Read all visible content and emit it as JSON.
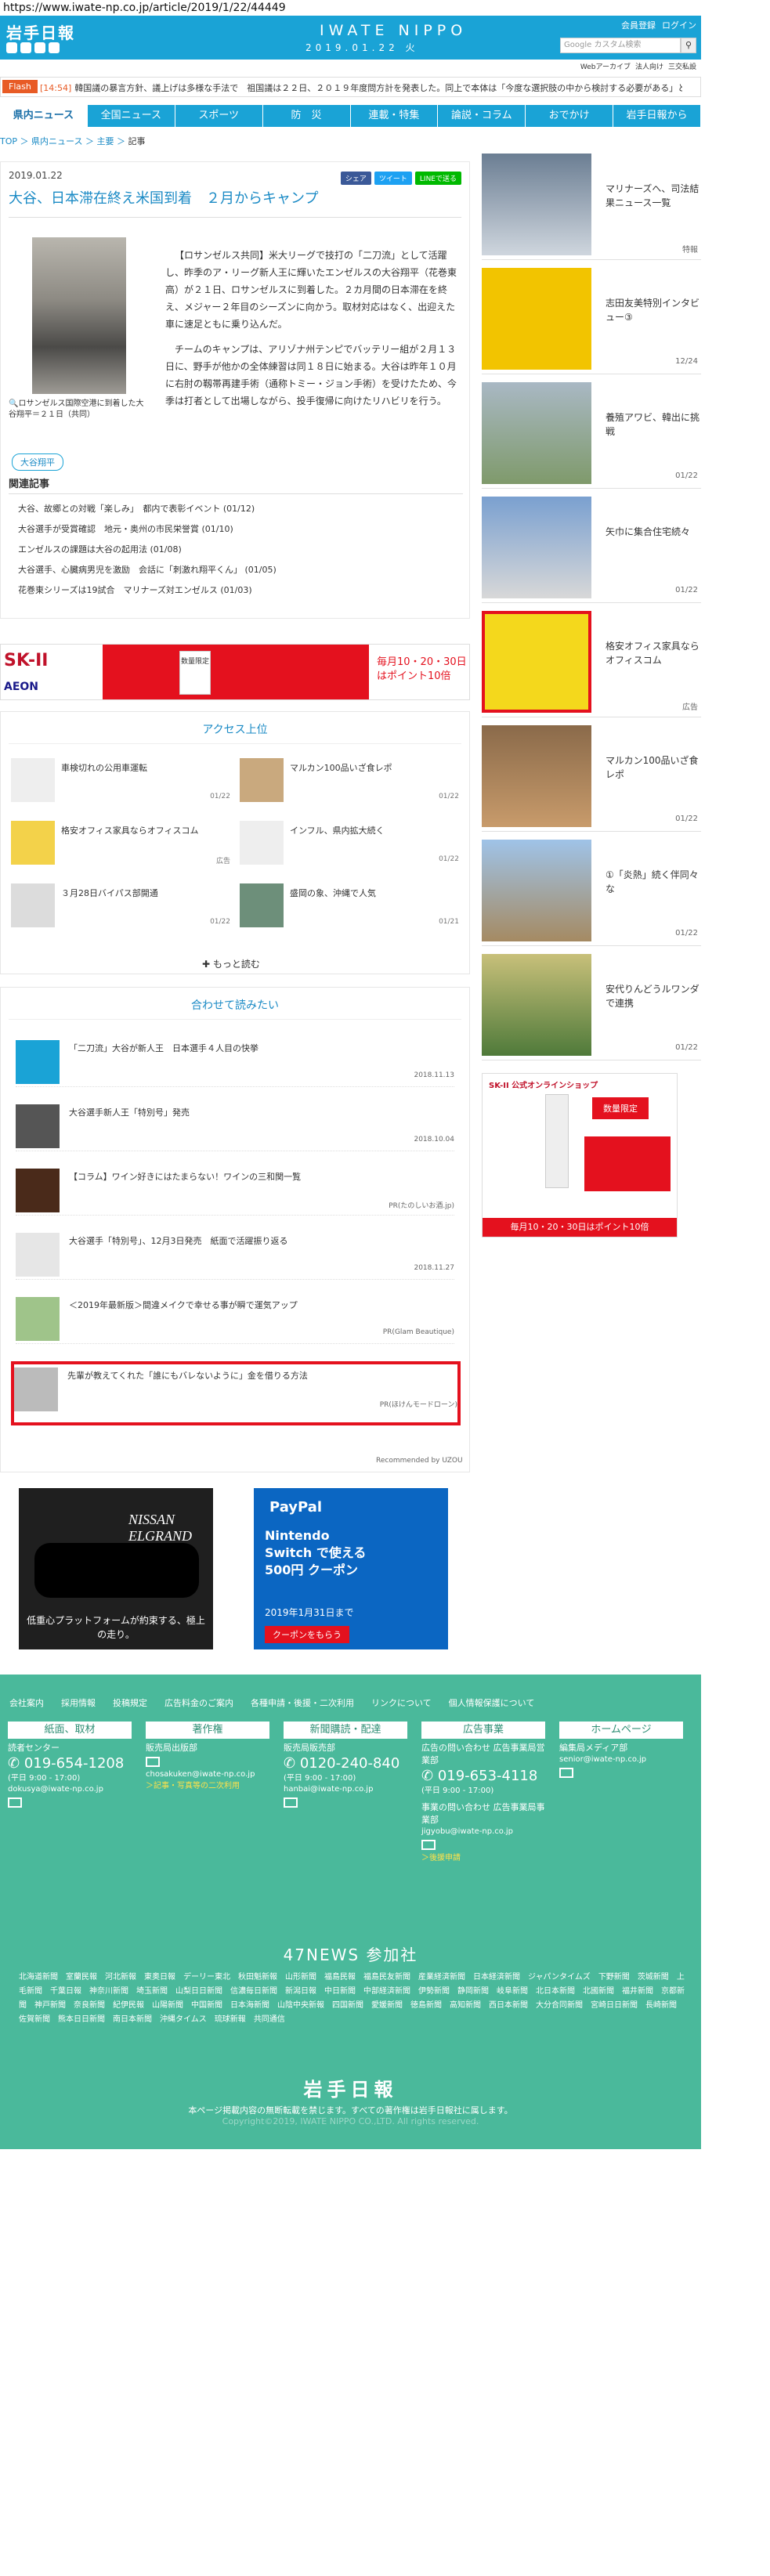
{
  "url": "https://www.iwate-np.co.jp/article/2019/1/22/44449",
  "header": {
    "logo": "岩手日報",
    "brand": "IWATE NIPPO",
    "date": "2019.01.22 火",
    "toplinks": [
      "会員登録",
      "ログイン"
    ],
    "sublinks": [
      "Webアーカイブ",
      "法人向け",
      "三交私設"
    ],
    "search_placeholder": "Google カスタム検索"
  },
  "flash": {
    "label": "Flash",
    "time": "[14:54]",
    "text": "韓国議の暴言方針、議上げは多様な手法で　祖国議は２２日、２０１９年度問方計を発表した。同上で本体は「今度な選択肢の中から検討する必要がある」と…"
  },
  "nav": [
    "県内ニュース",
    "全国ニュース",
    "スポーツ",
    "防　災",
    "連載・特集",
    "論説・コラム",
    "おでかけ",
    "岩手日報から"
  ],
  "breadcrumb": [
    "TOP",
    "県内ニュース",
    "主要",
    "記事"
  ],
  "article": {
    "date": "2019.01.22",
    "share": [
      "シェア",
      "ツイート",
      "LINEで送る"
    ],
    "title": "大谷、日本滞在終え米国到着　２月からキャンプ",
    "caption": "ロサンゼルス国際空港に到着した大谷翔平＝２１日（共同）",
    "body": [
      "【ロサンゼルス共同】米大リーグで技打の「二刀流」として活躍し、昨季のア・リーグ新人王に輝いたエンゼルスの大谷翔平（花巻東高）が２１日、ロサンゼルスに到着した。２カ月間の日本滞在を終え、メジャー２年目のシーズンに向かう。取材対応はなく、出迎えた車に速足ともに乗り込んだ。",
      "チームのキャンプは、アリゾナ州テンピでバッテリー組が２月１３日に、野手が他かの全体練習は同１８日に始まる。大谷は昨年１０月に右肘の靱帯再建手術（通称トミー・ジョン手術）を受けたため、今季は打者として出場しながら、投手復帰に向けたリハビリを行う。"
    ],
    "tag": "大谷翔平",
    "related_title": "関連記事",
    "related": [
      "大谷、故郷との対戦「楽しみ」　都内で表彰イベント (01/12)",
      "大谷選手が受賞確認　地元・奥州の市民栄誉賞 (01/10)",
      "エンゼルスの課題は大谷の起用法 (01/08)",
      "大谷選手、心臓病男児を激励　会話に「刺激れ翔平くん」 (01/05)",
      "花巻東シリーズは19試合　マリナーズ対エンゼルス (01/03)"
    ]
  },
  "ad_banner": {
    "brand": "SK-II",
    "sub": "AEON",
    "product_label": "数量限定",
    "points": "毎月10・20・30日はポイント10倍"
  },
  "access": {
    "title": "アクセス上位",
    "items": [
      {
        "title": "車検切れの公用車運転",
        "date": "01/22"
      },
      {
        "title": "マルカン100品いざ食レポ",
        "date": "01/22"
      },
      {
        "title": "格安オフィス家具ならオフィスコム",
        "date": "広告"
      },
      {
        "title": "インフル、県内拡大続く",
        "date": "01/22"
      },
      {
        "title": "３月28日バイパス部開通",
        "date": "01/22"
      },
      {
        "title": "盛岡の象、沖縄で人気",
        "date": "01/21"
      }
    ],
    "more": "もっと読む"
  },
  "recommend": {
    "title": "合わせて読みたい",
    "items": [
      {
        "title": "「二刀流」大谷が新人王　日本選手４人目の快挙",
        "meta": "2018.11.13"
      },
      {
        "title": "大谷選手新人王「特別号」発売",
        "meta": "2018.10.04"
      },
      {
        "title": "【コラム】ワイン好きにはたまらない！ワインの三和関一覧",
        "meta": "PR(たのしいお酒.jp)"
      },
      {
        "title": "大谷選手「特別号」、12月3日発売　紙面で活躍振り返る",
        "meta": "2018.11.27"
      },
      {
        "title": "＜2019年最新版＞間違メイクで幸せる事が瞬で運気アップ",
        "meta": "PR(Glam Beautique)"
      },
      {
        "title": "先輩が教えてくれた「誰にもバレないように」金を借りる方法",
        "meta": "PR(ほけんモードローン)"
      }
    ],
    "powered": "Recommended by UZOU"
  },
  "ads2": {
    "left_brand": "NISSAN ELGRAND",
    "left_text": "低重心プラットフォームが約束する、極上の走り。",
    "right_title": "PayPal",
    "right_text": "Nintendo Switch で使える 500円 クーポン",
    "right_date": "2019年1月31日まで",
    "right_button": "クーポンをもらう"
  },
  "sidebar": [
    {
      "title": "マリナーズへ、司法結果ニュース一覧",
      "date": "特報"
    },
    {
      "title": "志田友美特別インタビュー③",
      "date": "12/24"
    },
    {
      "title": "養殖アワビ、韓出に挑戦",
      "date": "01/22"
    },
    {
      "title": "矢巾に集合住宅続々",
      "date": "01/22"
    },
    {
      "title": "格安オフィス家具ならオフィスコム",
      "date": "広告"
    },
    {
      "title": "マルカン100品いざ食レポ",
      "date": "01/22"
    },
    {
      "title": "①「炎熱」続く伴同々な",
      "date": "01/22"
    },
    {
      "title": "安代りんどうルワンダで連携",
      "date": "01/22"
    }
  ],
  "side_ad": {
    "brand": "SK-II 公式オンラインショップ",
    "label": "数量限定",
    "points": "毎月10・20・30日はポイント10倍"
  },
  "footer": {
    "links": [
      "会社案内",
      "採用情報",
      "投稿規定",
      "広告料金のご案内",
      "各種申請・後援・二次利用",
      "リンクについて",
      "個人情報保護について"
    ],
    "cols": [
      {
        "head": "紙面、取材",
        "title": "読者センター",
        "tel": "019-654-1208",
        "hours": "(平日 9:00 - 17:00)",
        "mail": "dokusya@iwate-np.co.jp"
      },
      {
        "head": "著作権",
        "title": "販売局出版部",
        "mail": "chosakuken@iwate-np.co.jp",
        "link": "＞記事・写真等の二次利用"
      },
      {
        "head": "新聞購読・配達",
        "title": "販売局販売部",
        "tel": "0120-240-840",
        "hours": "(平日 9:00 - 17:00)",
        "mail": "hanbai@iwate-np.co.jp"
      },
      {
        "head": "広告事業",
        "title": "広告の問い合わせ 広告事業局営業部",
        "tel": "019-653-4118",
        "hours": "(平日 9:00 - 17:00)",
        "title2": "事業の問い合わせ 広告事業局事業部",
        "mail": "jigyobu@iwate-np.co.jp",
        "link": "＞後援申請"
      },
      {
        "head": "ホームページ",
        "title": "編集局メディア部",
        "mail": "senior@iwate-np.co.jp"
      }
    ],
    "n47": "47NEWS 参加社",
    "papers": [
      "北海道新聞",
      "室蘭民報",
      "河北新報",
      "東奥日報",
      "デーリー東北",
      "秋田魁新報",
      "山形新聞",
      "福島民報",
      "福島民友新聞",
      "産業経済新聞",
      "日本経済新聞",
      "ジャパンタイムズ",
      "下野新聞",
      "茨城新聞",
      "上毛新聞",
      "千葉日報",
      "神奈川新聞",
      "埼玉新聞",
      "山梨日日新聞",
      "信濃毎日新聞",
      "新潟日報",
      "中日新聞",
      "中部経済新聞",
      "伊勢新聞",
      "静岡新聞",
      "岐阜新聞",
      "北日本新聞",
      "北國新聞",
      "福井新聞",
      "京都新聞",
      "神戸新聞",
      "奈良新聞",
      "紀伊民報",
      "山陽新聞",
      "中国新聞",
      "日本海新聞",
      "山陰中央新報",
      "四国新聞",
      "愛媛新聞",
      "徳島新聞",
      "高知新聞",
      "西日本新聞",
      "大分合同新聞",
      "宮崎日日新聞",
      "長崎新聞",
      "佐賀新聞",
      "熊本日日新聞",
      "南日本新聞",
      "沖縄タイムス",
      "琉球新報",
      "共同通信"
    ],
    "logo": "岩手日報",
    "note": "本ページ掲載内容の無断転載を禁じます。すべての著作権は岩手日報社に属します。",
    "copy": "Copyright©2019, IWATE NIPPO CO.,LTD. All rights reserved."
  }
}
